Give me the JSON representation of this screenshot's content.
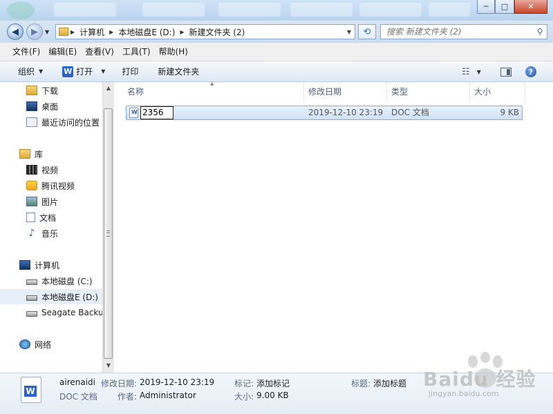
{
  "window": {
    "minimize": "─",
    "maximize": "□",
    "close": "✕"
  },
  "address": {
    "crumbs": [
      "计算机",
      "本地磁盘E (D:)",
      "新建文件夹 (2)"
    ]
  },
  "search": {
    "placeholder": "搜索 新建文件夹 (2)"
  },
  "menu": [
    "文件(F)",
    "编辑(E)",
    "查看(V)",
    "工具(T)",
    "帮助(H)"
  ],
  "toolbar": {
    "organize": "组织",
    "open": "打开",
    "print": "打印",
    "new_folder": "新建文件夹",
    "help": "?"
  },
  "nav": {
    "downloads": "下载",
    "desktop": "桌面",
    "recent": "最近访问的位置",
    "libraries": "库",
    "videos": "视频",
    "tencent_video": "腾讯视频",
    "pictures": "图片",
    "documents": "文档",
    "music": "音乐",
    "computer": "计算机",
    "drive_c": "本地磁盘 (C:)",
    "drive_e": "本地磁盘E (D:)",
    "seagate": "Seagate Backup",
    "network": "网络"
  },
  "columns": [
    "名称",
    "修改日期",
    "类型",
    "大小"
  ],
  "file": {
    "name": "2356",
    "modified": "2019-12-10 23:19",
    "type": "DOC 文档",
    "size": "9 KB"
  },
  "details": {
    "author_name": "airenaidi",
    "file_type": "DOC 文档",
    "modified_label": "修改日期:",
    "modified_value": "2019-12-10 23:19",
    "author_label": "作者:",
    "author_value": "Administrator",
    "tags_label": "标记:",
    "tags_value": "添加标记",
    "size_label": "大小:",
    "size_value": "9.00 KB",
    "title_label": "标题:",
    "title_value": "添加标题"
  },
  "watermark": {
    "brand": "Baidu 经验",
    "url": "jingyan.baidu.com"
  },
  "colors": {
    "selection": "#cfe2f8",
    "accent": "#2b63c6"
  }
}
